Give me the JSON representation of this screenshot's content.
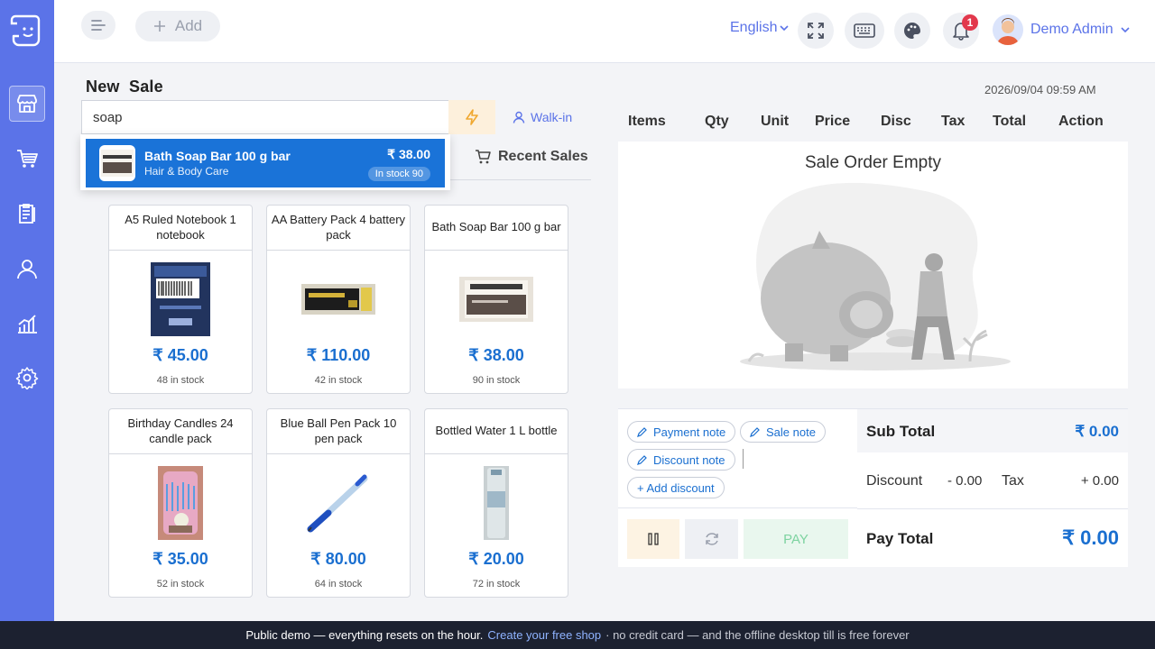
{
  "header": {
    "add_label": "Add",
    "language": "English",
    "notification_count": "1",
    "user_name": "Demo Admin"
  },
  "sale": {
    "title": "New  Sale",
    "datetime": "2026/09/04 09:59 AM",
    "search_value": "soap",
    "customer": "Walk-in",
    "recent_sales_label": "Recent Sales"
  },
  "search_results": [
    {
      "name": "Bath Soap Bar 100 g bar",
      "category": "Hair & Body Care",
      "price": "₹ 38.00",
      "stock": "In stock 90"
    }
  ],
  "products": [
    {
      "name": "A5 Ruled Notebook 1 notebook",
      "price": "₹ 45.00",
      "stock": "48 in stock"
    },
    {
      "name": "AA Battery Pack 4 battery pack",
      "price": "₹ 110.00",
      "stock": "42 in stock"
    },
    {
      "name": "Bath Soap Bar 100 g bar",
      "price": "₹ 38.00",
      "stock": "90 in stock"
    },
    {
      "name": "Birthday Candles 24 candle pack",
      "price": "₹ 35.00",
      "stock": "52 in stock"
    },
    {
      "name": "Blue Ball Pen Pack 10 pen pack",
      "price": "₹ 80.00",
      "stock": "64 in stock"
    },
    {
      "name": "Bottled Water 1 L bottle",
      "price": "₹ 20.00",
      "stock": "72 in stock"
    }
  ],
  "order_table": {
    "columns": [
      "Items",
      "Qty",
      "Unit",
      "Price",
      "Disc",
      "Tax",
      "Total",
      "Action"
    ],
    "empty_message": "Sale Order Empty"
  },
  "notes": {
    "payment_note": "Payment note",
    "sale_note": "Sale note",
    "discount_note": "Discount note",
    "add_discount": "+ Add discount"
  },
  "actions": {
    "pay_label": "PAY"
  },
  "totals": {
    "sub_total_label": "Sub Total",
    "sub_total_value": "₹ 0.00",
    "discount_label": "Discount",
    "discount_value": "- 0.00",
    "tax_label": "Tax",
    "tax_value": "+ 0.00",
    "pay_total_label": "Pay Total",
    "pay_total_value": "₹ 0.00"
  },
  "footer": {
    "text1": "Public demo — everything resets on the hour.",
    "link": "Create your free shop",
    "text2": "· no credit card — and the offline desktop till is free forever"
  },
  "icons": {
    "sidebar": [
      "store-icon",
      "cart-icon",
      "clipboard-icon",
      "user-icon",
      "chart-icon",
      "settings-icon"
    ],
    "header": [
      "menu-icon",
      "plus-icon",
      "fullscreen-icon",
      "keyboard-icon",
      "palette-icon",
      "bell-icon"
    ]
  },
  "colors": {
    "sidebar": "#5b73e8",
    "accent": "#1a6fd0",
    "highlight": "#1a73d8",
    "pay_button": "#e9f7ee",
    "footer": "#1c2130"
  }
}
